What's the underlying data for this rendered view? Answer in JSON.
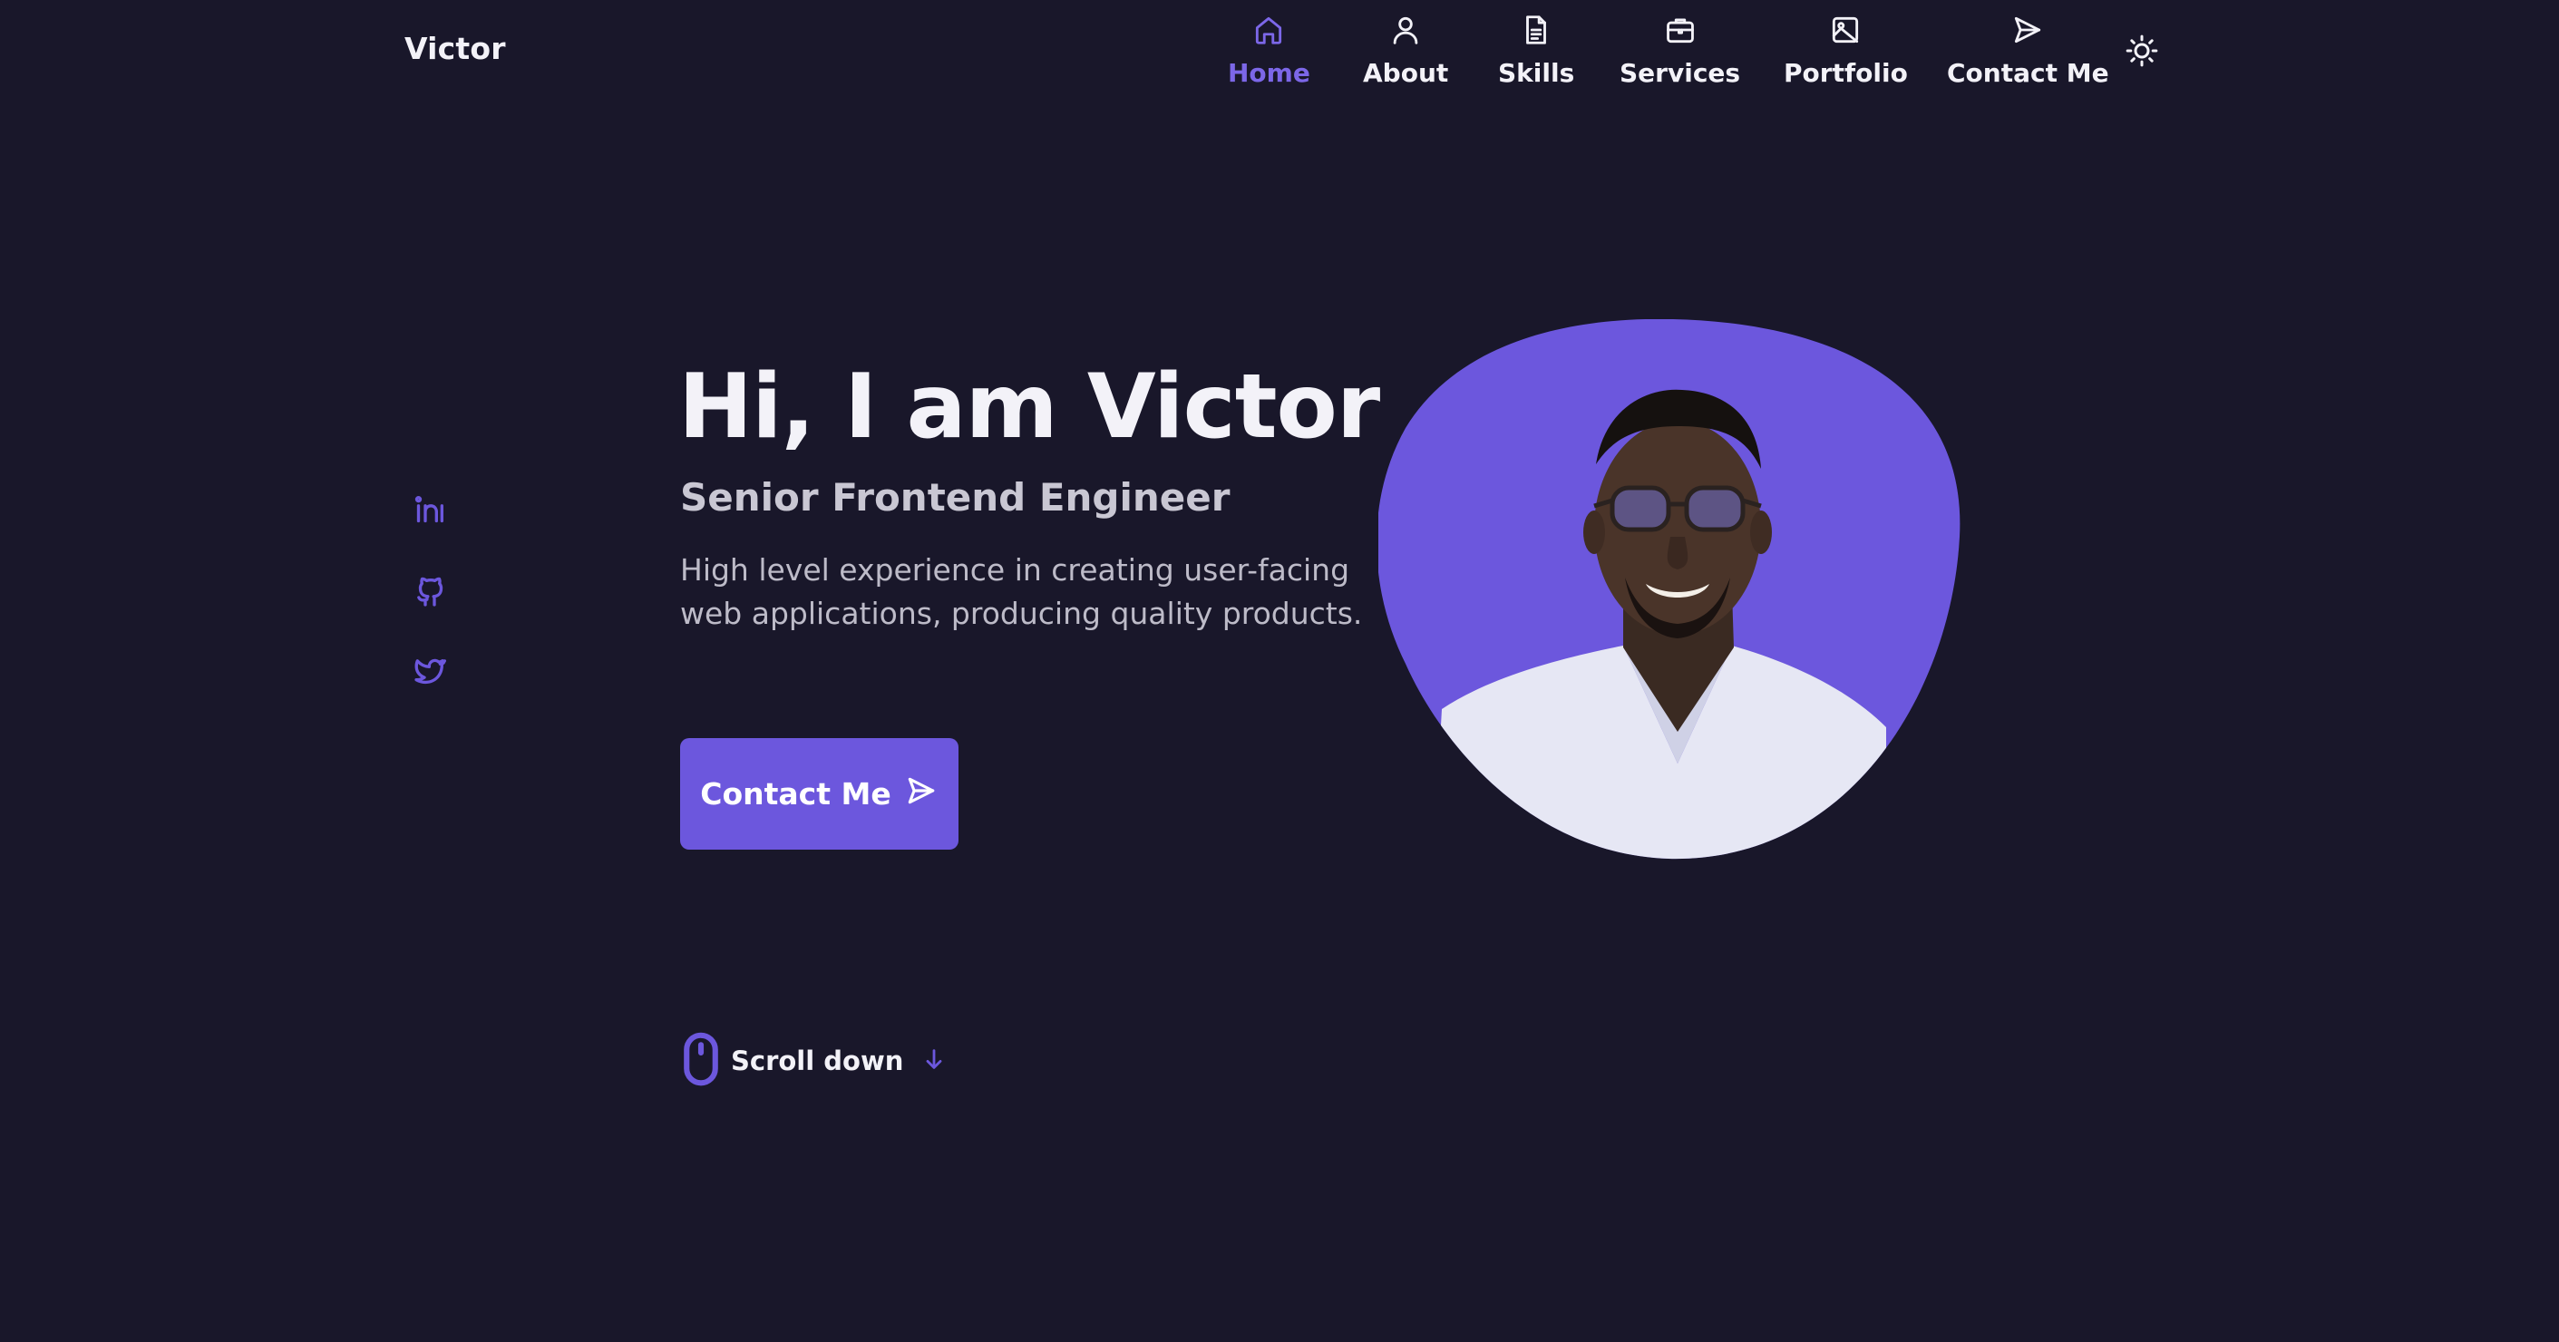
{
  "header": {
    "logo": "Victor",
    "nav": [
      {
        "label": "Home",
        "icon": "home-icon",
        "active": true
      },
      {
        "label": "About",
        "icon": "user-icon",
        "active": false
      },
      {
        "label": "Skills",
        "icon": "file-icon",
        "active": false
      },
      {
        "label": "Services",
        "icon": "briefcase-icon",
        "active": false
      },
      {
        "label": "Portfolio",
        "icon": "image-icon",
        "active": false
      },
      {
        "label": "Contact Me",
        "icon": "send-icon",
        "active": false
      }
    ],
    "theme_toggle_icon": "sun-icon"
  },
  "social": [
    "linkedin-icon",
    "github-icon",
    "twitter-icon"
  ],
  "hero": {
    "title": "Hi, I am Victor",
    "subtitle": "Senior Frontend Engineer",
    "description": "High level experience in creating user-facing web applications, producing quality products.",
    "cta_label": "Contact Me",
    "cta_icon": "send-icon"
  },
  "scroll": {
    "label": "Scroll down",
    "icon": "mouse-icon",
    "arrow_icon": "arrow-down-icon"
  },
  "colors": {
    "background": "#19172a",
    "accent": "#6c57dd",
    "nav_active": "#7c67e8",
    "text": "#f3f2f8",
    "muted_text": "#bdbbc8"
  }
}
